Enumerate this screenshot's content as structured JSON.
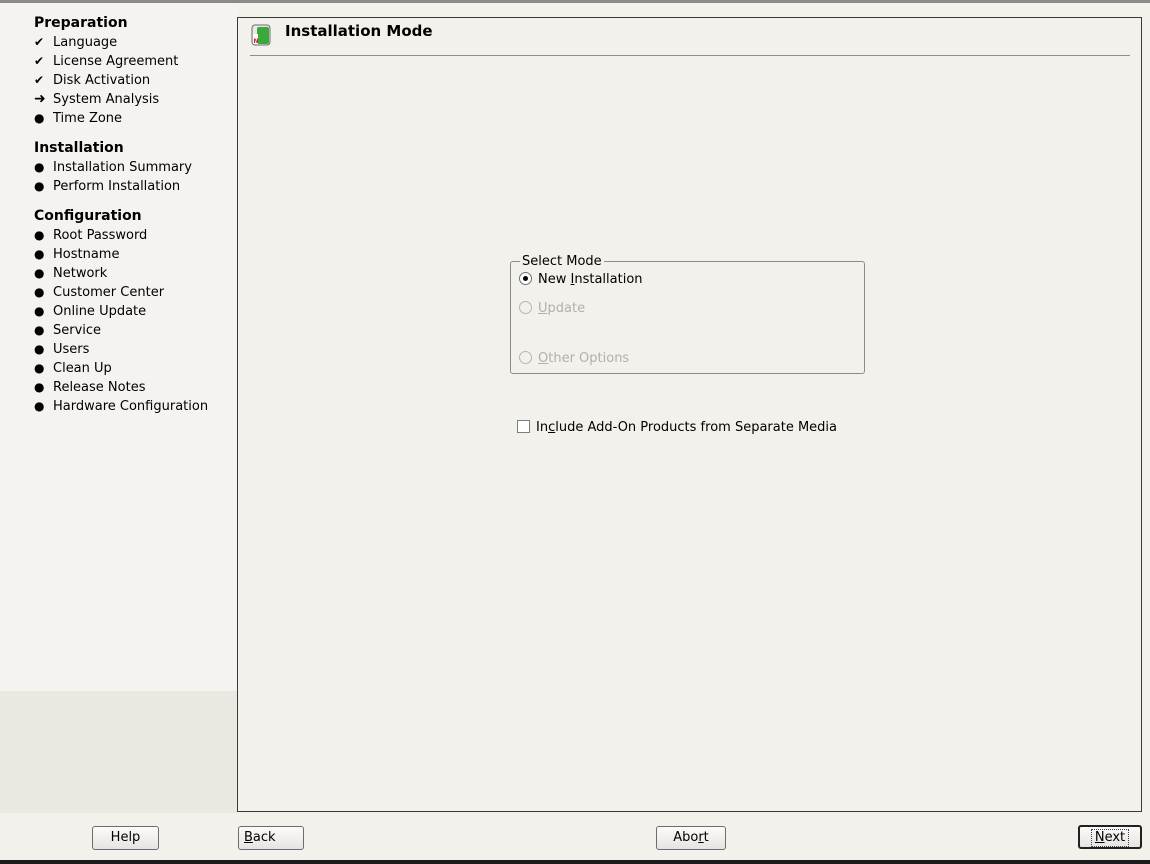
{
  "sidebar": {
    "groups": [
      {
        "title": "Preparation",
        "steps": [
          {
            "label": "Language",
            "status": "done",
            "mark": "✔"
          },
          {
            "label": "License Agreement",
            "status": "done",
            "mark": "✔"
          },
          {
            "label": "Disk Activation",
            "status": "done",
            "mark": "✔"
          },
          {
            "label": "System Analysis",
            "status": "current",
            "mark": "➜"
          },
          {
            "label": "Time Zone",
            "status": "todo",
            "mark": "●"
          }
        ]
      },
      {
        "title": "Installation",
        "steps": [
          {
            "label": "Installation Summary",
            "status": "todo",
            "mark": "●"
          },
          {
            "label": "Perform Installation",
            "status": "todo",
            "mark": "●"
          }
        ]
      },
      {
        "title": "Configuration",
        "steps": [
          {
            "label": "Root Password",
            "status": "todo",
            "mark": "●"
          },
          {
            "label": "Hostname",
            "status": "todo",
            "mark": "●"
          },
          {
            "label": "Network",
            "status": "todo",
            "mark": "●"
          },
          {
            "label": "Customer Center",
            "status": "todo",
            "mark": "●"
          },
          {
            "label": "Online Update",
            "status": "todo",
            "mark": "●"
          },
          {
            "label": "Service",
            "status": "todo",
            "mark": "●"
          },
          {
            "label": "Users",
            "status": "todo",
            "mark": "●"
          },
          {
            "label": "Clean Up",
            "status": "todo",
            "mark": "●"
          },
          {
            "label": "Release Notes",
            "status": "todo",
            "mark": "●"
          },
          {
            "label": "Hardware Configuration",
            "status": "todo",
            "mark": "●"
          }
        ]
      }
    ]
  },
  "main": {
    "title": "Installation Mode",
    "icon": "installer-icon",
    "select_mode": {
      "label": "Select Mode",
      "options": [
        {
          "pre": "New ",
          "key": "I",
          "post": "nstallation",
          "checked": true,
          "enabled": true
        },
        {
          "pre": "",
          "key": "U",
          "post": "pdate",
          "checked": false,
          "enabled": false
        },
        {
          "pre": "",
          "key": "O",
          "post": "ther Options",
          "checked": false,
          "enabled": false
        }
      ]
    },
    "addon": {
      "pre": "In",
      "key": "c",
      "post": "lude Add-On Products from Separate Media",
      "checked": false
    }
  },
  "buttons": {
    "help": "Help",
    "back": {
      "pre": "",
      "key": "B",
      "post": "ack"
    },
    "abort": {
      "pre": "Abo",
      "key": "r",
      "post": "t"
    },
    "next": {
      "pre": "",
      "key": "N",
      "post": "ext"
    }
  },
  "colors": {
    "accent_green": "#3aa83a",
    "icon_red": "#c0272d"
  }
}
